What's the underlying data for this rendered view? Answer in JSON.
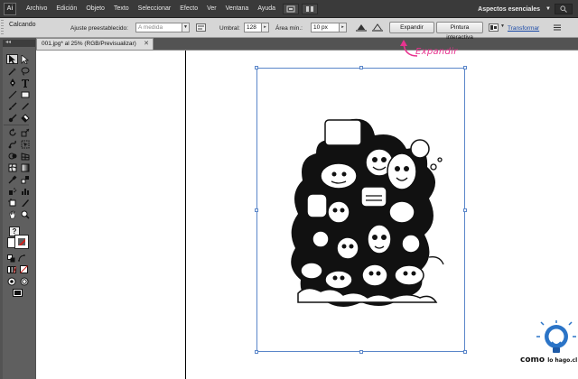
{
  "menubar": {
    "app_icon": "Ai",
    "items": [
      "Archivo",
      "Edición",
      "Objeto",
      "Texto",
      "Seleccionar",
      "Efecto",
      "Ver",
      "Ventana",
      "Ayuda"
    ],
    "workspace_label": "Aspectos esenciales",
    "workspace_arrow": "▼"
  },
  "controlbar": {
    "title": "Calcando",
    "preset_label": "Ajuste preestablecido:",
    "preset_value": "A medida",
    "threshold_label": "Umbral:",
    "threshold_value": "128",
    "min_area_label": "Área mín.:",
    "min_area_value": "10 px",
    "expand_button": "Expandir",
    "live_paint_button": "Pintura interactiva",
    "transform_link": "Transformar"
  },
  "document_tab": {
    "title": "001.jpg* al 25% (RGB/Previsualizar)",
    "close": "✕"
  },
  "tools": [
    "selection-tool",
    "direct-selection-tool",
    "magic-wand-tool",
    "lasso-tool",
    "pen-tool",
    "type-tool",
    "line-tool",
    "rectangle-tool",
    "paintbrush-tool",
    "pencil-tool",
    "blob-brush-tool",
    "eraser-tool",
    "rotate-tool",
    "scale-tool",
    "warp-tool",
    "free-transform-tool",
    "shape-builder-tool",
    "perspective-grid-tool",
    "mesh-tool",
    "gradient-tool",
    "eyedropper-tool",
    "blend-tool",
    "symbol-sprayer-tool",
    "column-graph-tool",
    "artboard-tool",
    "slice-tool",
    "hand-tool",
    "zoom-tool"
  ],
  "toolbar_question": "?",
  "annotation": {
    "text": "Expandir",
    "color": "#e8338f"
  },
  "logo": {
    "word_1": "como",
    "word_2": "lo hago",
    "suffix": ".cl"
  },
  "colors": {
    "artboard_border": "#5a86c9",
    "ui_dark": "#3a3a3a",
    "panel": "#d6d6d6"
  }
}
